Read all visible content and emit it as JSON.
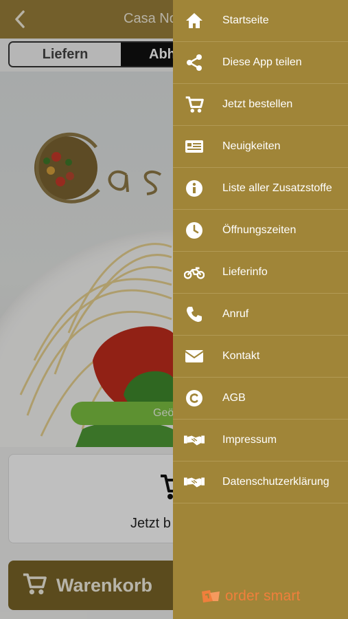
{
  "header": {
    "title": "Casa No"
  },
  "order_mode": {
    "deliver": "Liefern",
    "pickup": "Abholen",
    "selected": "Abholen"
  },
  "hero": {
    "status_pill": "Geö"
  },
  "order_card": {
    "label": "Jetzt b"
  },
  "basket": {
    "label": "Warenkorb"
  },
  "menu": {
    "items": [
      {
        "label": "Startseite",
        "icon": "home-icon"
      },
      {
        "label": "Diese App teilen",
        "icon": "share-icon"
      },
      {
        "label": "Jetzt bestellen",
        "icon": "cart-icon"
      },
      {
        "label": "Neuigkeiten",
        "icon": "news-icon"
      },
      {
        "label": "Liste aller Zusatzstoffe",
        "icon": "info-icon"
      },
      {
        "label": "Öffnungszeiten",
        "icon": "clock-icon"
      },
      {
        "label": "Lieferinfo",
        "icon": "motorcycle-icon"
      },
      {
        "label": "Anruf",
        "icon": "phone-icon"
      },
      {
        "label": "Kontakt",
        "icon": "mail-icon"
      },
      {
        "label": "AGB",
        "icon": "copyright-icon"
      },
      {
        "label": "Impressum",
        "icon": "handshake-icon"
      },
      {
        "label": "Datenschutzerklärung",
        "icon": "handshake-icon"
      }
    ]
  },
  "brand": {
    "name": "order smart"
  },
  "colors": {
    "drawer": "#a08538",
    "topbar": "#9a7f3a",
    "open_pill": "#7cc242",
    "brand": "#f07f3c"
  }
}
